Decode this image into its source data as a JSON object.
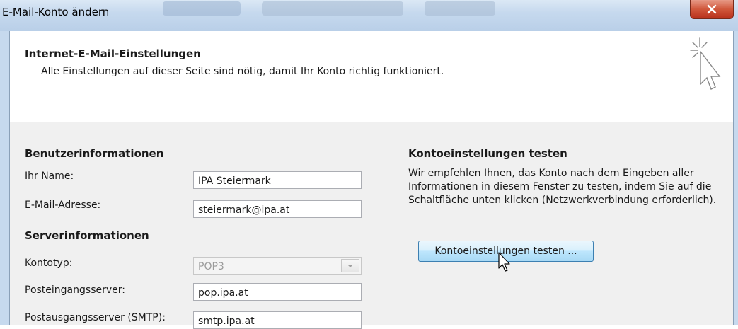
{
  "window": {
    "title": "E-Mail-Konto ändern"
  },
  "header": {
    "title": "Internet-E-Mail-Einstellungen",
    "subtitle": "Alle Einstellungen auf dieser Seite sind nötig, damit Ihr Konto richtig funktioniert."
  },
  "user_info": {
    "heading": "Benutzerinformationen",
    "name_label": "Ihr Name:",
    "name_value": "IPA Steiermark",
    "email_label": "E-Mail-Adresse:",
    "email_value": "steiermark@ipa.at"
  },
  "server_info": {
    "heading": "Serverinformationen",
    "account_type_label": "Kontotyp:",
    "account_type_value": "POP3",
    "incoming_label": "Posteingangsserver:",
    "incoming_value": "pop.ipa.at",
    "outgoing_label": "Postausgangsserver (SMTP):",
    "outgoing_value": "smtp.ipa.at"
  },
  "test_settings": {
    "heading": "Kontoeinstellungen testen",
    "description": "Wir empfehlen Ihnen, das Konto nach dem Eingeben aller Informationen in diesem Fenster zu testen, indem Sie auf die Schaltfläche unten klicken (Netzwerkverbindung erforderlich).",
    "button_label": "Kontoeinstellungen testen ..."
  },
  "icons": {
    "close": "close-icon",
    "header": "sparkle-cursor-icon",
    "dropdown": "chevron-down-icon",
    "pointer": "mouse-pointer-icon"
  },
  "colors": {
    "titlebar": "#c6d9ee",
    "close_button": "#c8452c",
    "test_button_border": "#3c7fb1"
  }
}
